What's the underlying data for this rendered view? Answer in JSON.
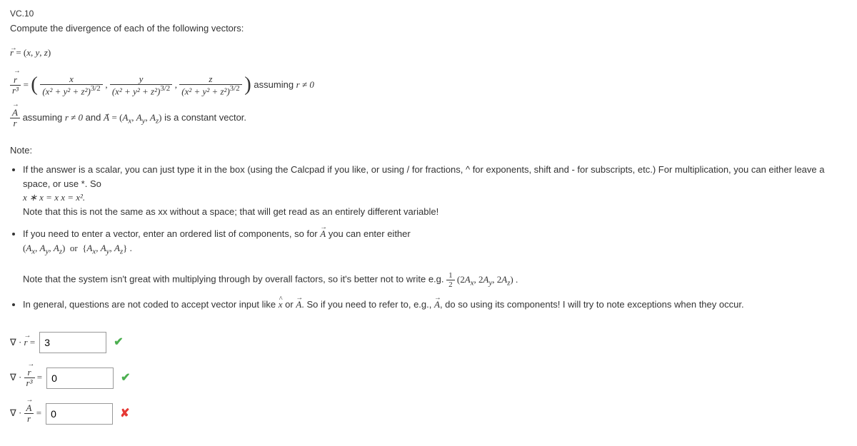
{
  "question_id": "VC.10",
  "prompt": "Compute the divergence of each of the following vectors:",
  "definitions": {
    "r_vec": "r⃗ = (x, y, z)",
    "r3_line_prefix": " = ",
    "frac_x": "x",
    "frac_y": "y",
    "frac_z": "z",
    "den": "(x² + y² + z²)³ᐟ²",
    "assuming": " assuming ",
    "r_ne_0": "r ≠ 0",
    "A_over_r_suffix": " assuming r ≠ 0 and ",
    "A_def": " = (Aₓ, Aᵧ, A_z) is a constant vector."
  },
  "note_header": "Note:",
  "notes": {
    "n1a": "If the answer is a scalar, you can just type it in the box (using the Calcpad if you like, or using / for fractions, ^ for exponents, shift and - for subscripts, etc.) For multiplication, you can either leave a space, or use *. So",
    "n1b": "x ∗ x = x x = x².",
    "n1c": "Note that this is not the same as xx without a space; that will get read as an entirely different variable!",
    "n2a": "If you need to enter a vector, enter an ordered list of components, so for ",
    "n2b": " you can enter either",
    "n2c": "(Aₓ, Aᵧ, A_z)  or  {Aₓ, Aᵧ, A_z} .",
    "n2d": "Note that the system isn't great with multiplying through by overall factors, so it's better not to write e.g. ",
    "n2e": "½ (2Aₓ, 2Aᵧ, 2A_z) .",
    "n3a": "In general, questions are not coded to accept vector input like ",
    "n3b": " or ",
    "n3c": ". So if you need to refer to, e.g., ",
    "n3d": ", do so using its components! I will try to note exceptions when they occur."
  },
  "answers": {
    "a1": {
      "label_prefix": "∇ · ",
      "label_suffix": " = ",
      "value": "3",
      "correct": true
    },
    "a2": {
      "label_prefix": "∇ · ",
      "label_suffix": " = ",
      "value": "0",
      "correct": true
    },
    "a3": {
      "label_prefix": "∇ · ",
      "label_suffix": " = ",
      "value": "0",
      "correct": false
    }
  },
  "marks": {
    "check": "✔",
    "cross": "✘"
  }
}
